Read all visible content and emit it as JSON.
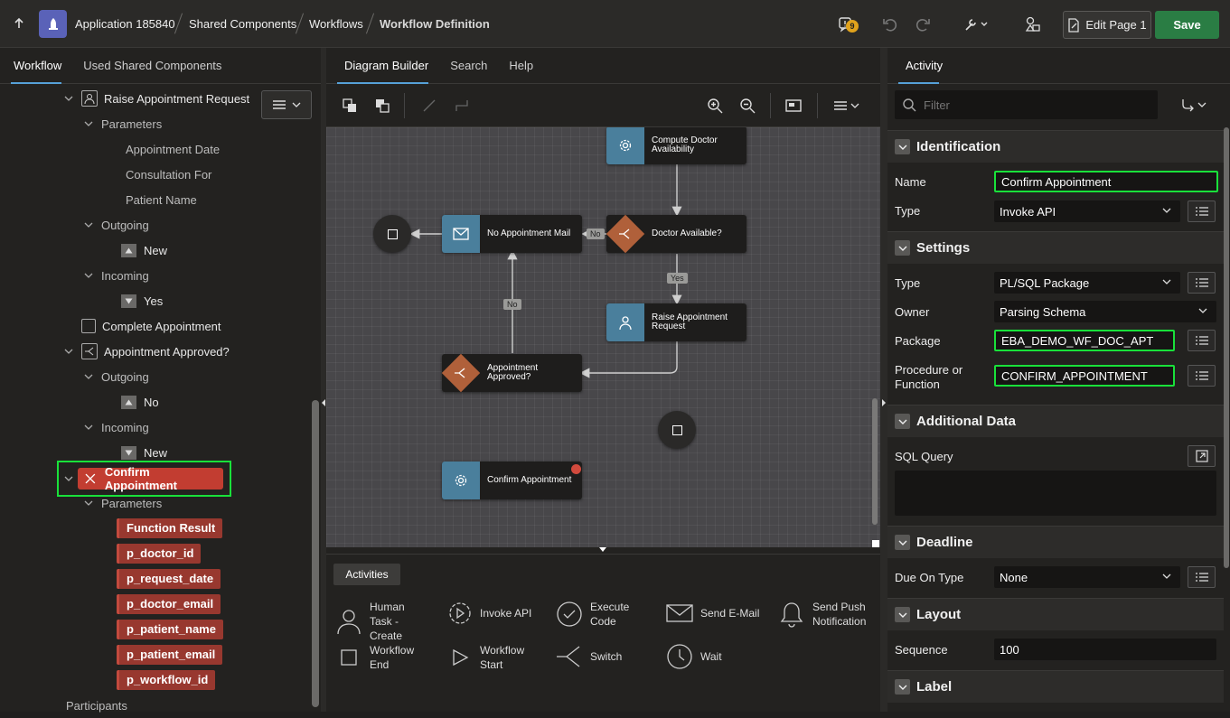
{
  "topbar": {
    "app_name": "Application 185840",
    "crumbs": [
      "Shared Components",
      "Workflows",
      "Workflow Definition"
    ],
    "badge_count": "9",
    "edit_page": "Edit Page 1",
    "save": "Save"
  },
  "left": {
    "tabs": [
      "Workflow",
      "Used Shared Components"
    ],
    "tree": {
      "raise_request": "Raise Appointment Request",
      "parameters": "Parameters",
      "appointment_date": "Appointment Date",
      "consultation_for": "Consultation For",
      "patient_name": "Patient Name",
      "outgoing": "Outgoing",
      "new": "New",
      "incoming": "Incoming",
      "yes": "Yes",
      "complete_appointment": "Complete Appointment",
      "appointment_approved": "Appointment Approved?",
      "outgoing2": "Outgoing",
      "no": "No",
      "incoming2": "Incoming",
      "new2": "New",
      "confirm_appointment": "Confirm Appointment",
      "parameters2": "Parameters",
      "params": [
        "Function Result",
        "p_doctor_id",
        "p_request_date",
        "p_doctor_email",
        "p_patient_name",
        "p_patient_email",
        "p_workflow_id"
      ],
      "participants": "Participants"
    }
  },
  "center": {
    "tabs": [
      "Diagram Builder",
      "Search",
      "Help"
    ],
    "nodes": {
      "compute": "Compute Doctor Availability",
      "doctor_available": "Doctor Available?",
      "no_mail": "No Appointment Mail",
      "raise": "Raise Appointment Request",
      "approved": "Appointment Approved?",
      "confirm": "Confirm Appointment"
    },
    "edges": {
      "no1": "No",
      "yes": "Yes",
      "no2": "No"
    },
    "palette": {
      "tab": "Activities",
      "items": [
        "Human Task - Create",
        "Invoke API",
        "Execute Code",
        "Send E-Mail",
        "Send Push Notification",
        "Workflow End",
        "Workflow Start",
        "Switch",
        "Wait"
      ]
    }
  },
  "right": {
    "tab": "Activity",
    "filter_placeholder": "Filter",
    "sections": {
      "identification": "Identification",
      "settings": "Settings",
      "additional": "Additional Data",
      "deadline": "Deadline",
      "layout": "Layout",
      "label": "Label"
    },
    "props": {
      "name_label": "Name",
      "name_value": "Confirm Appointment",
      "type_label": "Type",
      "type_value": "Invoke API",
      "stype_label": "Type",
      "stype_value": "PL/SQL Package",
      "owner_label": "Owner",
      "owner_value": "Parsing Schema",
      "package_label": "Package",
      "package_value": "EBA_DEMO_WF_DOC_APT",
      "proc_label": "Procedure or Function",
      "proc_value": "CONFIRM_APPOINTMENT",
      "sql_label": "SQL Query",
      "due_label": "Due On Type",
      "due_value": "None",
      "seq_label": "Sequence",
      "seq_value": "100"
    }
  }
}
